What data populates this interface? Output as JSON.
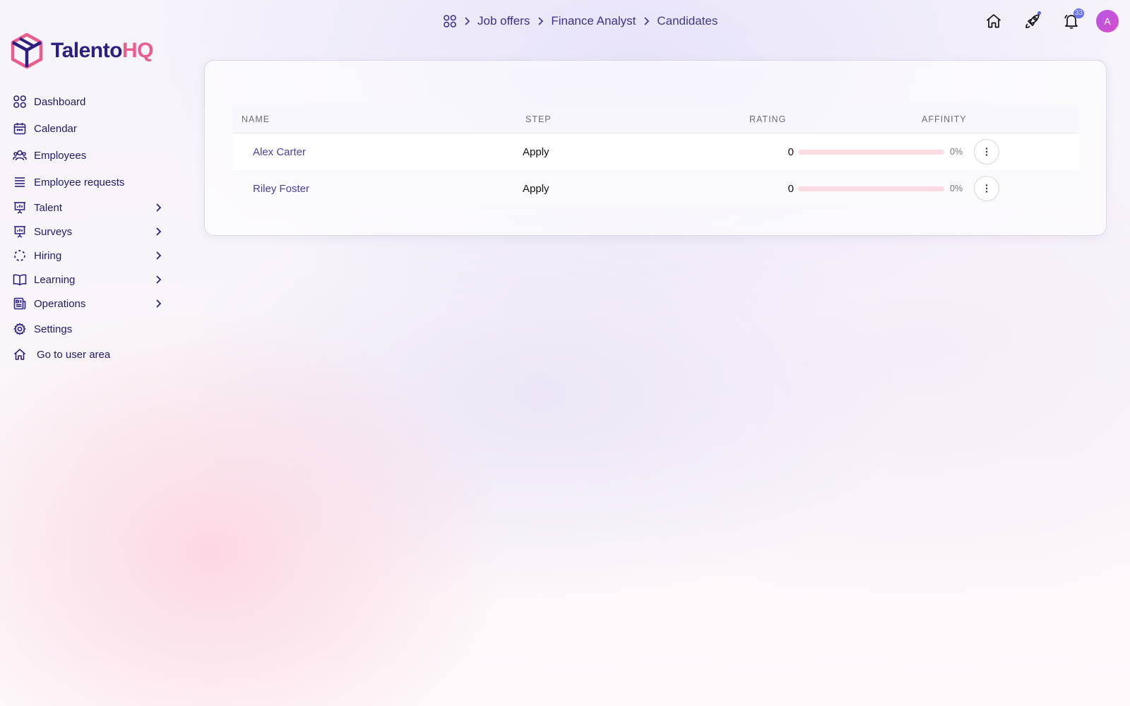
{
  "brand": {
    "name_part1": "Talento",
    "name_part2": "HQ",
    "colors": {
      "primary": "#2b2080",
      "accent": "#e95d8e"
    }
  },
  "sidebar": {
    "items": [
      {
        "label": "Dashboard",
        "icon": "dashboard-grid-icon",
        "has_submenu": false
      },
      {
        "label": "Calendar",
        "icon": "calendar-icon",
        "has_submenu": false
      },
      {
        "label": "Employees",
        "icon": "users-icon",
        "has_submenu": false
      },
      {
        "label": "Employee requests",
        "icon": "list-icon",
        "has_submenu": false
      },
      {
        "label": "Talent",
        "icon": "presentation-chart-icon",
        "has_submenu": true
      },
      {
        "label": "Surveys",
        "icon": "presentation-chart-icon",
        "has_submenu": true
      },
      {
        "label": "Hiring",
        "icon": "dashed-circle-icon",
        "has_submenu": true
      },
      {
        "label": "Learning",
        "icon": "book-icon",
        "has_submenu": true
      },
      {
        "label": "Operations",
        "icon": "document-icon",
        "has_submenu": true
      },
      {
        "label": "Settings",
        "icon": "gear-icon",
        "has_submenu": false
      },
      {
        "label": "Go to user area",
        "icon": "home-icon",
        "has_submenu": false
      }
    ]
  },
  "breadcrumb": {
    "items": [
      {
        "label": "Job offers"
      },
      {
        "label": "Finance Analyst"
      },
      {
        "label": "Candidates"
      }
    ]
  },
  "header": {
    "notifications_count": "33",
    "avatar_initial": "A"
  },
  "table": {
    "columns": {
      "name": "NAME",
      "step": "STEP",
      "rating": "RATING",
      "affinity": "AFFINITY"
    },
    "rows": [
      {
        "name": "Alex Carter",
        "step": "Apply",
        "rating": "0",
        "affinity_label": "0%",
        "affinity_value": 0
      },
      {
        "name": "Riley Foster",
        "step": "Apply",
        "rating": "0",
        "affinity_label": "0%",
        "affinity_value": 0
      }
    ]
  }
}
